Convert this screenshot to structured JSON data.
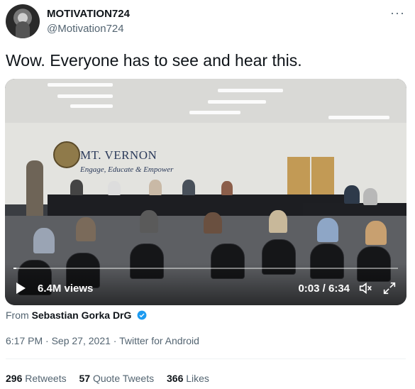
{
  "author": {
    "name": "MOTIVATION724",
    "handle": "@Motivation724"
  },
  "more_label": "···",
  "tweet": {
    "text": "Wow. Everyone has to see and hear this."
  },
  "video": {
    "views": "6.4M views",
    "time": "0:03 / 6:34",
    "progress": 0.008,
    "scene": {
      "banner_title": "MT. VERNON",
      "banner_tagline": "Engage, Educate & Empower"
    }
  },
  "source": {
    "prefix": "From",
    "name": "Sebastian Gorka DrG"
  },
  "meta": {
    "time": "6:17 PM",
    "date": "Sep 27, 2021",
    "client": "Twitter for Android",
    "separator": "·"
  },
  "stats": {
    "retweets_count": "296",
    "retweets_label": "Retweets",
    "quotes_count": "57",
    "quotes_label": "Quote Tweets",
    "likes_count": "366",
    "likes_label": "Likes"
  },
  "colors": {
    "verified": "#1d9bf0",
    "secondary_text": "#536471"
  },
  "icons": {
    "play": "play-icon",
    "mute": "mute-icon",
    "fullscreen": "fullscreen-icon",
    "verified": "verified-badge-icon"
  }
}
